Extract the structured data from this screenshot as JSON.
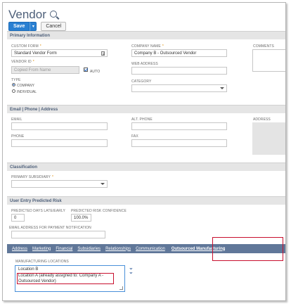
{
  "page": {
    "title": "Vendor"
  },
  "actions": {
    "save_label": "Save",
    "save_menu": "▾",
    "cancel_label": "Cancel"
  },
  "sections": {
    "primary": "Primary Information",
    "contact": "Email | Phone | Address",
    "classification": "Classification",
    "risk": "User Entry Predicted Risk"
  },
  "primary": {
    "custom_form_label": "CUSTOM FORM",
    "custom_form_value": "Standard Vendor Form",
    "company_name_label": "COMPANY NAME",
    "company_name_value": "Company B - Outsourced Vendor",
    "comments_label": "COMMENTS",
    "vendor_id_label": "VENDOR ID",
    "vendor_id_placeholder": "Copied From Name",
    "auto_label": "AUTO",
    "web_address_label": "WEB ADDRESS",
    "type_label": "TYPE",
    "type_options": [
      "COMPANY",
      "INDIVIDUAL"
    ],
    "category_label": "CATEGORY"
  },
  "contact": {
    "email_label": "EMAIL",
    "alt_phone_label": "ALT. PHONE",
    "address_label": "ADDRESS",
    "phone_label": "PHONE",
    "fax_label": "FAX"
  },
  "classification": {
    "primary_subsidiary_label": "PRIMARY SUBSIDIARY"
  },
  "risk": {
    "predicted_days_label": "PREDICTED DAYS LATE/EARLY",
    "predicted_days_value": "0",
    "confidence_label": "PREDICTED RISK CONFIDENCE",
    "confidence_value": "100.0%",
    "email_notification_label": "EMAIL ADDRESS FOR PAYMENT NOTIFICATION"
  },
  "tabs": [
    "Address",
    "Marketing",
    "Financial",
    "Subsidiaries",
    "Relationships",
    "Communication",
    "Outsourced Manufacturing"
  ],
  "active_tab": "Outsourced Manufacturing",
  "manufacturing": {
    "label": "MANUFACTURING LOCATIONS",
    "lines": [
      "Location B",
      "Location A (already assigned to: Company A -",
      "Outsourced Vendor)"
    ]
  },
  "colors": {
    "accent": "#2a80d2",
    "tab_bar": "#607799",
    "title": "#4d5f79",
    "highlight": "#c8102e",
    "required": "#e08a00"
  }
}
